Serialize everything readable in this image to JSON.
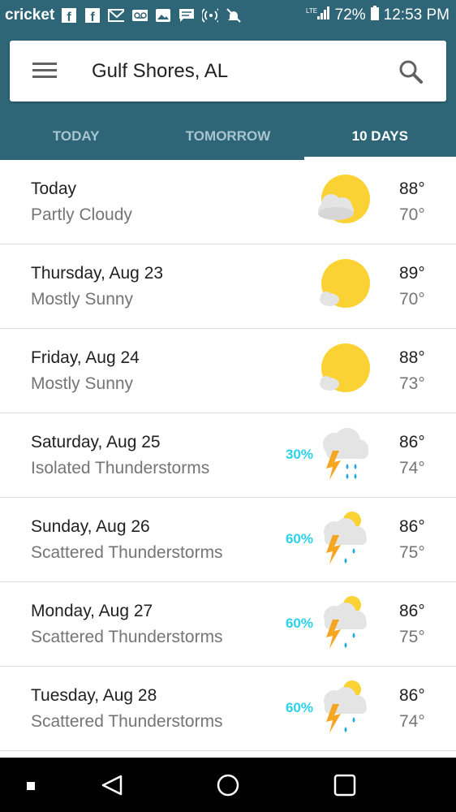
{
  "status_bar": {
    "carrier": "cricket",
    "battery": "72%",
    "time": "12:53 PM",
    "network": "LTE",
    "icons": [
      "facebook-icon",
      "facebook-icon",
      "gmail-icon",
      "voicemail-icon",
      "image-icon",
      "message-icon",
      "hotspot-icon",
      "mute-icon",
      "signal-icon",
      "battery-icon"
    ]
  },
  "search": {
    "location": "Gulf Shores, AL"
  },
  "tabs": [
    {
      "label": "TODAY",
      "active": false
    },
    {
      "label": "TOMORROW",
      "active": false
    },
    {
      "label": "10 DAYS",
      "active": true
    }
  ],
  "forecast": [
    {
      "day": "Today",
      "condition": "Partly Cloudy",
      "precip": "",
      "high": "88°",
      "low": "70°",
      "icon": "partly-cloudy-icon"
    },
    {
      "day": "Thursday, Aug 23",
      "condition": "Mostly Sunny",
      "precip": "",
      "high": "89°",
      "low": "70°",
      "icon": "mostly-sunny-icon"
    },
    {
      "day": "Friday, Aug 24",
      "condition": "Mostly Sunny",
      "precip": "",
      "high": "88°",
      "low": "73°",
      "icon": "mostly-sunny-icon"
    },
    {
      "day": "Saturday, Aug 25",
      "condition": "Isolated Thunderstorms",
      "precip": "30%",
      "high": "86°",
      "low": "74°",
      "icon": "thunderstorm-icon"
    },
    {
      "day": "Sunday, Aug 26",
      "condition": "Scattered Thunderstorms",
      "precip": "60%",
      "high": "86°",
      "low": "75°",
      "icon": "scattered-thunderstorm-icon"
    },
    {
      "day": "Monday, Aug 27",
      "condition": "Scattered Thunderstorms",
      "precip": "60%",
      "high": "86°",
      "low": "75°",
      "icon": "scattered-thunderstorm-icon"
    },
    {
      "day": "Tuesday, Aug 28",
      "condition": "Scattered Thunderstorms",
      "precip": "60%",
      "high": "86°",
      "low": "74°",
      "icon": "scattered-thunderstorm-icon"
    }
  ],
  "colors": {
    "header": "#2e6677",
    "precip": "#29d3ea",
    "sun": "#fbd233",
    "cloud": "#e4e4e4",
    "bolt": "#f5a623",
    "rain": "#1ea7e1"
  }
}
